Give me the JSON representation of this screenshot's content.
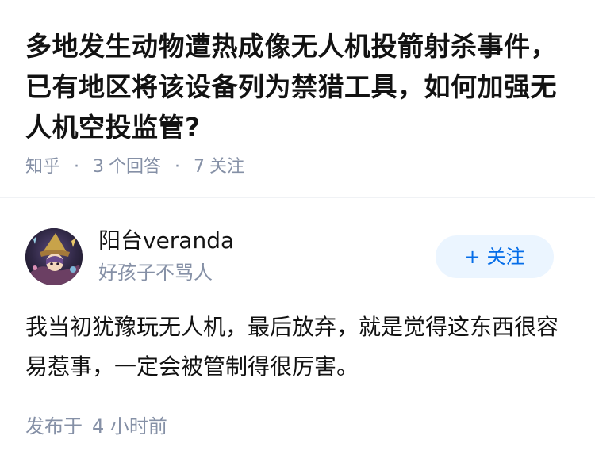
{
  "question": {
    "title": "多地发生动物遭热成像无人机投箭射杀事件，已有地区将该设备列为禁猎工具，如何加强无人机空投监管?",
    "source": "知乎",
    "answer_count": "3",
    "answer_label": "个回答",
    "follower_count": "7",
    "follower_label": "关注",
    "separator": "·"
  },
  "answer": {
    "author": {
      "name": "阳台veranda",
      "bio": "好孩子不骂人",
      "avatar_icon": "avatar-image"
    },
    "follow_button": {
      "icon": "+",
      "label": "关注"
    },
    "content": "我当初犹豫玩无人机，最后放弃，就是觉得这东西很容易惹事，一定会被管制得很厉害。",
    "published_label": "发布于",
    "published_time": "4 小时前"
  },
  "colors": {
    "title": "#121212",
    "meta": "#8590a6",
    "accent": "#056de8",
    "accent_bg": "#ebf5ff",
    "divider": "#f0f2f5"
  }
}
